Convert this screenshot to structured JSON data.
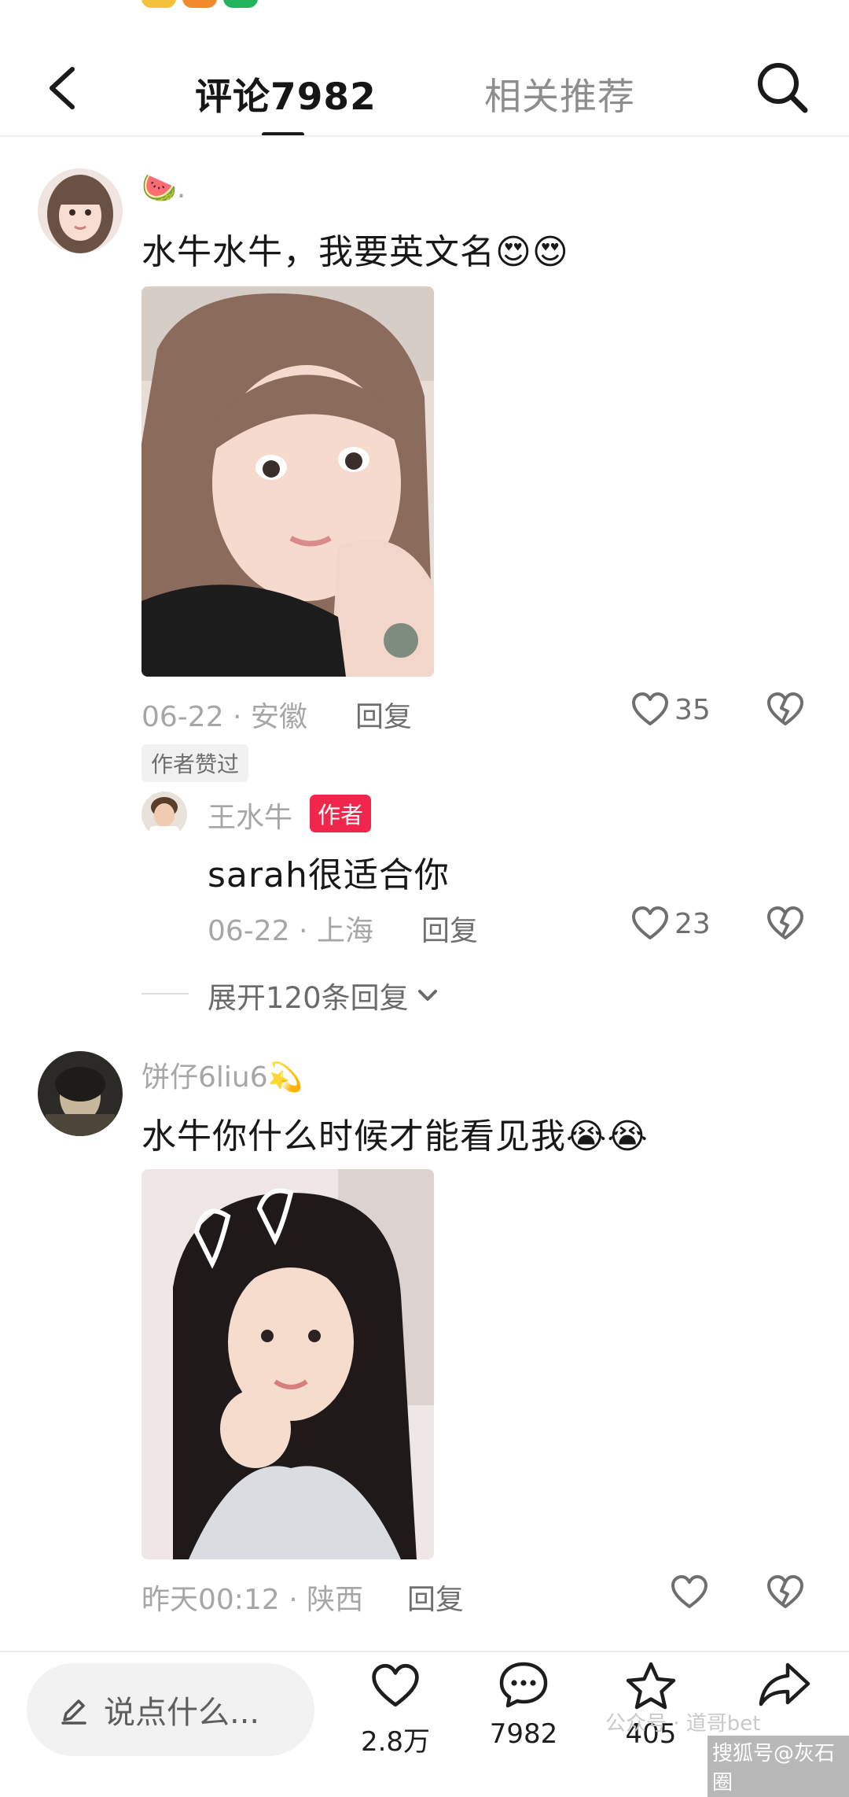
{
  "header": {
    "comments_tab": "评论7982",
    "related_tab": "相关推荐"
  },
  "comments": [
    {
      "username": "🍉.",
      "text": "水牛水牛，我要英文名😍😍",
      "date_location": "06-22 · 安徽",
      "reply_label": "回复",
      "like_count": "35",
      "author_liked": "作者赞过"
    },
    {
      "username": "饼仔6liu6💫",
      "text": "水牛你什么时候才能看见我😭😭",
      "date_location": "昨天00:12 · 陕西",
      "reply_label": "回复",
      "like_count": ""
    }
  ],
  "reply": {
    "username": "王水牛",
    "badge": "作者",
    "text": "sarah很适合你",
    "date_location": "06-22 · 上海",
    "reply_label": "回复",
    "like_count": "23"
  },
  "expand_replies": "展开120条回复",
  "bottom_bar": {
    "input_placeholder": "说点什么...",
    "like_count": "2.8万",
    "comment_count": "7982",
    "favorite_count": "405",
    "share_count": ""
  },
  "watermarks": {
    "official_account": "公众号 · 道哥bet",
    "sohu": "搜狐号@灰石圈"
  },
  "colors": {
    "author_badge": "#f0264d",
    "muted_text": "#a6a6a6"
  }
}
